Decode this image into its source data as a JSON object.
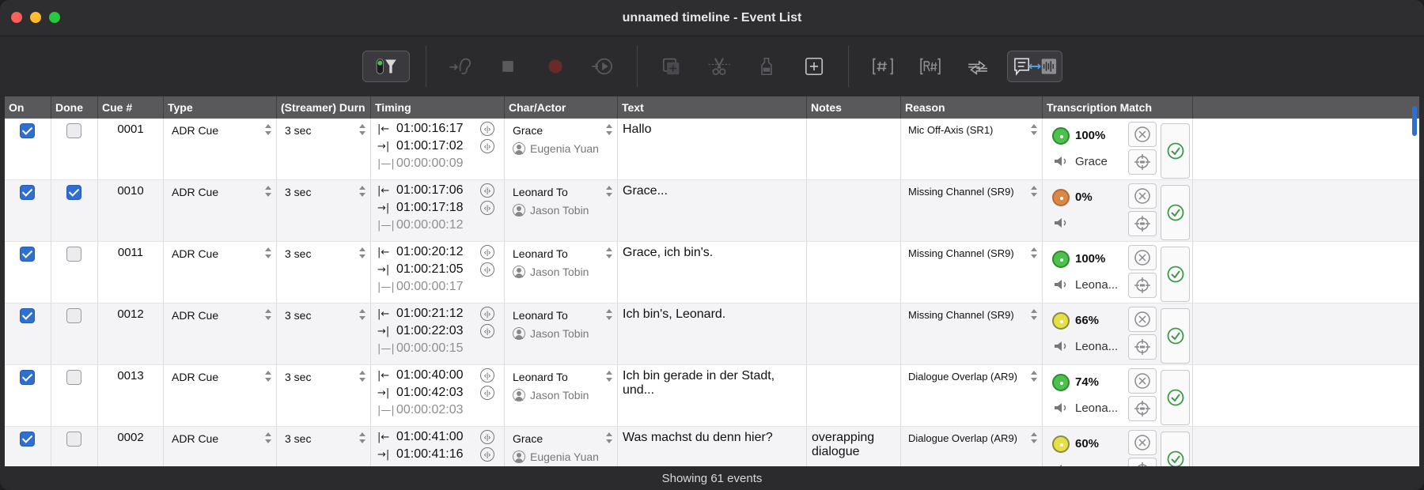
{
  "window": {
    "title": "unnamed timeline - Event List"
  },
  "toolbar": {
    "icons": [
      "filter-toggle-icon",
      "listen-icon",
      "stop-icon",
      "record-icon",
      "playback-icon",
      "add-take-icon",
      "cut-icon",
      "bottle-icon",
      "add-event-icon",
      "cue-number-icon",
      "renumber-icon",
      "swap-icon",
      "transcription-icon"
    ]
  },
  "columns": [
    "On",
    "Done",
    "Cue #",
    "Type",
    "(Streamer) Durn",
    "Timing",
    "Char/Actor",
    "Text",
    "Notes",
    "Reason",
    "Transcription Match"
  ],
  "rows": [
    {
      "on": true,
      "done": false,
      "cue": "0001",
      "type": "ADR Cue",
      "durn": "3 sec",
      "t_in": "01:00:16:17",
      "t_out": "01:00:17:02",
      "t_len": "00:00:00:09",
      "char": "Grace",
      "actor": "Eugenia Yuan",
      "text": "Hallo",
      "notes": "",
      "reason": "Mic Off-Axis (SR1)",
      "match": "100%",
      "match_level": 1.0,
      "match_color": "#4cc24c",
      "speaker": "Grace"
    },
    {
      "on": true,
      "done": true,
      "cue": "0010",
      "type": "ADR Cue",
      "durn": "3 sec",
      "t_in": "01:00:17:06",
      "t_out": "01:00:17:18",
      "t_len": "00:00:00:12",
      "char": "Leonard To",
      "actor": "Jason Tobin",
      "text": "Grace...",
      "notes": "",
      "reason": "Missing Channel (SR9)",
      "match": "0%",
      "match_level": 0.0,
      "match_color": "#d8894a",
      "speaker": ""
    },
    {
      "on": true,
      "done": false,
      "cue": "0011",
      "type": "ADR Cue",
      "durn": "3 sec",
      "t_in": "01:00:20:12",
      "t_out": "01:00:21:05",
      "t_len": "00:00:00:17",
      "char": "Leonard To",
      "actor": "Jason Tobin",
      "text": "Grace, ich bin's.",
      "notes": "",
      "reason": "Missing Channel (SR9)",
      "match": "100%",
      "match_level": 1.0,
      "match_color": "#4cc24c",
      "speaker": "Leona..."
    },
    {
      "on": true,
      "done": false,
      "cue": "0012",
      "type": "ADR Cue",
      "durn": "3 sec",
      "t_in": "01:00:21:12",
      "t_out": "01:00:22:03",
      "t_len": "00:00:00:15",
      "char": "Leonard To",
      "actor": "Jason Tobin",
      "text": "Ich bin's, Leonard.",
      "notes": "",
      "reason": "Missing Channel (SR9)",
      "match": "66%",
      "match_level": 0.66,
      "match_color": "#e5e04a",
      "speaker": "Leona..."
    },
    {
      "on": true,
      "done": false,
      "cue": "0013",
      "type": "ADR Cue",
      "durn": "3 sec",
      "t_in": "01:00:40:00",
      "t_out": "01:00:42:03",
      "t_len": "00:00:02:03",
      "char": "Leonard To",
      "actor": "Jason Tobin",
      "text": "Ich bin gerade in der Stadt, und...",
      "notes": "",
      "reason": "Dialogue Overlap (AR9)",
      "match": "74%",
      "match_level": 0.74,
      "match_color": "#4cc24c",
      "speaker": "Leona..."
    },
    {
      "on": true,
      "done": false,
      "cue": "0002",
      "type": "ADR Cue",
      "durn": "3 sec",
      "t_in": "01:00:41:00",
      "t_out": "01:00:41:16",
      "t_len": "",
      "char": "Grace",
      "actor": "Eugenia Yuan",
      "text": "Was machst du denn hier?",
      "notes": "overapping dialogue",
      "reason": "Dialogue Overlap (AR9)",
      "match": "60%",
      "match_level": 0.6,
      "match_color": "#e5e04a",
      "speaker": ""
    }
  ],
  "status": {
    "text": "Showing 61 events"
  }
}
